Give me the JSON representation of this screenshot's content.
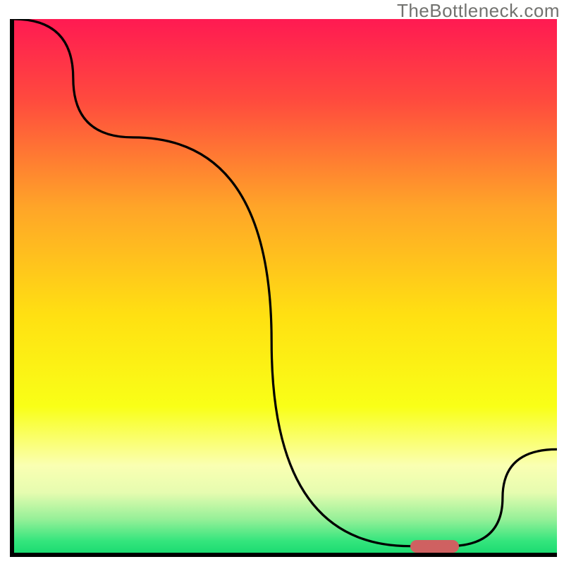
{
  "watermark": "TheBottleneck.com",
  "chart_data": {
    "type": "line",
    "title": "",
    "xlabel": "",
    "ylabel": "",
    "xlim": [
      0,
      100
    ],
    "ylim": [
      0,
      100
    ],
    "curve": {
      "x": [
        0,
        22,
        73,
        80,
        100
      ],
      "y": [
        100,
        78,
        2,
        2,
        20
      ]
    },
    "optimal_zone": {
      "x_start": 73,
      "x_end": 82,
      "y": 2
    },
    "gradient_stops": [
      {
        "pct": 0,
        "color": "#ff1a52"
      },
      {
        "pct": 15,
        "color": "#ff4a3e"
      },
      {
        "pct": 35,
        "color": "#ffa528"
      },
      {
        "pct": 55,
        "color": "#ffe012"
      },
      {
        "pct": 72,
        "color": "#f9ff17"
      },
      {
        "pct": 83,
        "color": "#faffb2"
      },
      {
        "pct": 88,
        "color": "#e6fcb0"
      },
      {
        "pct": 93,
        "color": "#95f098"
      },
      {
        "pct": 97,
        "color": "#35e57d"
      },
      {
        "pct": 100,
        "color": "#13d86d"
      }
    ],
    "pill_color": "#cf6161",
    "axis_color": "#000000"
  }
}
